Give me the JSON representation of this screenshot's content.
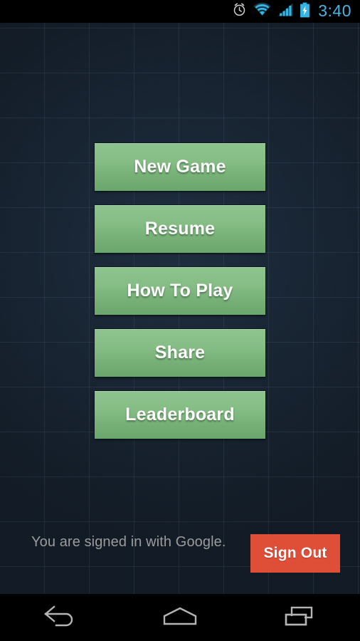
{
  "status_bar": {
    "time": "3:40",
    "icons": [
      {
        "name": "alarm-clock-icon",
        "label": "Alarm set"
      },
      {
        "name": "wifi-icon",
        "label": "Wi-Fi connected"
      },
      {
        "name": "cellular-signal-icon",
        "label": "Cellular signal"
      },
      {
        "name": "battery-charging-icon",
        "label": "Battery charging"
      }
    ],
    "background_color": "#000000",
    "icon_color": "#33b5e5",
    "time_color": "#4ab3e0"
  },
  "wallpaper": {
    "background_color": "#131d28",
    "grid_line_color": "#283646",
    "grid_size_px": 63
  },
  "menu": {
    "buttons": [
      {
        "id": "new-game",
        "label": "New Game"
      },
      {
        "id": "resume",
        "label": "Resume"
      },
      {
        "id": "how-to-play",
        "label": "How To Play"
      },
      {
        "id": "share",
        "label": "Share"
      },
      {
        "id": "leaderboard",
        "label": "Leaderboard"
      }
    ],
    "button_color_top": "#8ec38d",
    "button_color_bottom": "#6aa76c",
    "button_text_color": "#ffffff"
  },
  "footer": {
    "signin_status": "You are signed in with Google.",
    "signin_status_color": "#9b9b9b",
    "signout_label": "Sign Out",
    "signout_color": "#df4e37",
    "signout_text_color": "#ffffff"
  },
  "nav_bar": {
    "background_color": "#000000",
    "icon_color": "#b4b4b4",
    "buttons": [
      {
        "id": "back",
        "name": "back-icon",
        "label": "Back"
      },
      {
        "id": "home",
        "name": "home-icon",
        "label": "Home"
      },
      {
        "id": "recents",
        "name": "recents-icon",
        "label": "Recent apps"
      }
    ]
  }
}
